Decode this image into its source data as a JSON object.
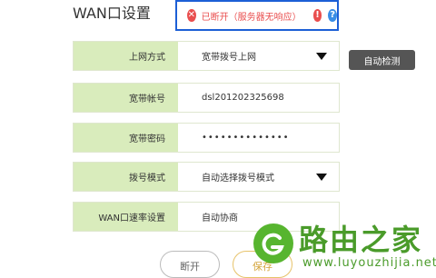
{
  "page": {
    "title": "WAN口设置"
  },
  "status": {
    "text": "已断开（服务器无响应）",
    "error_icon": "close-circle-icon",
    "alert_icon": "alert-icon",
    "help_icon": "help-icon",
    "color": "#e94e4e"
  },
  "form": {
    "rows": [
      {
        "label": "上网方式",
        "value": "宽带拨号上网"
      },
      {
        "label": "宽带帐号",
        "value": "dsl201202325698"
      },
      {
        "label": "宽带密码",
        "value": "••••••••••••••"
      },
      {
        "label": "拨号模式",
        "value": "自动选择拨号模式"
      },
      {
        "label": "WAN口速率设置",
        "value": "自动协商"
      }
    ]
  },
  "buttons": {
    "detect": "自动检测",
    "disconnect": "断开",
    "save": "保存"
  },
  "watermark": {
    "brand": "路由之家",
    "url": "www.luyouzhijia.net",
    "color": "#4a9b2a"
  },
  "colors": {
    "label_bg": "#d9ecbc",
    "status_border": "#1c5fd6",
    "detect_bg": "#555555"
  }
}
